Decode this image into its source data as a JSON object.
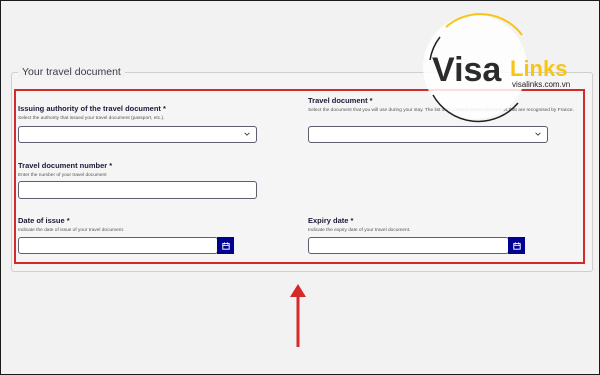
{
  "section": {
    "legend": "Your travel document"
  },
  "fields": {
    "issuing_authority": {
      "label": "Issuing authority of the travel document *",
      "hint": "Select the authority that issued your travel document (passport, etc.)."
    },
    "travel_document": {
      "label": "Travel document *",
      "hint": "Select the document that you will use during your stay. The list only contains travel documents that are recognised by France."
    },
    "document_number": {
      "label": "Travel document number *",
      "hint": "Enter the number of your travel document"
    },
    "date_of_issue": {
      "label": "Date of issue *",
      "hint": "Indicate the date of issue of your travel document."
    },
    "expiry_date": {
      "label": "Expiry date *",
      "hint": "Indicate the expiry date of your travel document."
    }
  },
  "watermark": {
    "brand_visa": "Visa",
    "brand_links": "Links",
    "domain": "visalinks.com.vn",
    "colors": {
      "brand_dark": "#2b2b2b",
      "brand_accent": "#f5c518",
      "circle": "#222222"
    }
  },
  "colors": {
    "highlight": "#d42a2a",
    "calendar_button": "#000091",
    "arrow": "#d42a2a"
  },
  "icons": [
    "chevron-down-icon",
    "calendar-icon",
    "up-arrow-icon"
  ]
}
